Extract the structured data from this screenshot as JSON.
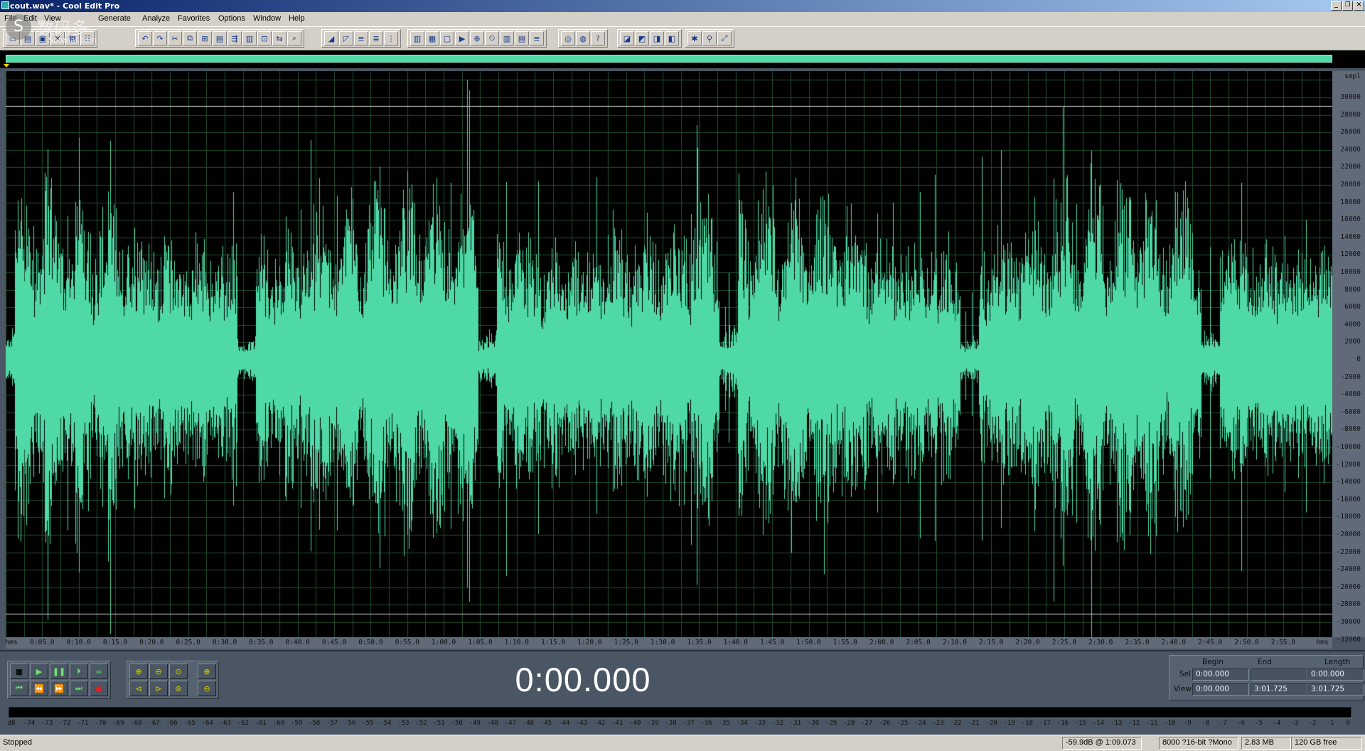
{
  "window": {
    "title": "cout.wav* - Cool Edit Pro",
    "controls": [
      "_",
      "❐",
      "✕"
    ]
  },
  "menu": [
    "File",
    "Edit",
    "View",
    "Generate",
    "Analyze",
    "Favorites",
    "Options",
    "Window",
    "Help"
  ],
  "watermark": {
    "mark": "S",
    "text": "数码多",
    "url": "Soomal.com"
  },
  "toolbar_groups": [
    [
      "new-icon",
      "open-icon",
      "save-icon",
      "close-icon",
      "save-as-icon",
      "properties-icon"
    ],
    [
      "undo-icon",
      "redo-icon",
      "cut-icon",
      "copy-icon",
      "copy-new-icon",
      "paste-icon",
      "paste-mix-icon",
      "mix-paste-icon",
      "trim-icon",
      "convert-icon",
      "find-icon"
    ],
    [
      "envelope-icon",
      "amplify-icon",
      "eq-icon",
      "noise-icon",
      "delay-icon"
    ],
    [
      "snap-icon",
      "grid-icon",
      "frame-icon",
      "play-icon",
      "zoom-icon",
      "time-icon",
      "meter-icon",
      "spectral-icon",
      "cue-icon"
    ],
    [
      "cd-icon",
      "batch-icon",
      "help-icon"
    ],
    [
      "multitrack-icon",
      "edit-view-icon",
      "cd-view-icon",
      "script-icon"
    ],
    [
      "dither-icon",
      "link-icon",
      "hotkey-icon"
    ]
  ],
  "waveform": {
    "color": "#4fd9a6",
    "background": "#000000",
    "grid_color": "#1f4f2f",
    "y_axis_unit": "smpl",
    "y_labels": [
      "30000",
      "28000",
      "26000",
      "24000",
      "22000",
      "20000",
      "18000",
      "16000",
      "14000",
      "12000",
      "10000",
      "8000",
      "6000",
      "4000",
      "2000",
      "0",
      "-2000",
      "-4000",
      "-6000",
      "-8000",
      "-10000",
      "-12000",
      "-14000",
      "-16000",
      "-18000",
      "-20000",
      "-22000",
      "-24000",
      "-26000",
      "-28000",
      "-30000",
      "-32000"
    ],
    "x_axis_unit": "hms",
    "x_labels": [
      "0:05.0",
      "0:10.0",
      "0:15.0",
      "0:20.0",
      "0:25.0",
      "0:30.0",
      "0:35.0",
      "0:40.0",
      "0:45.0",
      "0:50.0",
      "0:55.0",
      "1:00.0",
      "1:05.0",
      "1:10.0",
      "1:15.0",
      "1:20.0",
      "1:25.0",
      "1:30.0",
      "1:35.0",
      "1:40.0",
      "1:45.0",
      "1:50.0",
      "1:55.0",
      "2:00.0",
      "2:05.0",
      "2:10.0",
      "2:15.0",
      "2:20.0",
      "2:25.0",
      "2:30.0",
      "2:35.0",
      "2:40.0",
      "2:45.0",
      "2:50.0",
      "2:55.0"
    ]
  },
  "transport": {
    "row1": [
      "stop-icon",
      "play-icon",
      "pause-icon",
      "play-to-end-icon",
      "loop-icon"
    ],
    "row2": [
      "go-to-start-icon",
      "rewind-icon",
      "fast-forward-icon",
      "go-to-end-icon",
      "record-icon"
    ],
    "zoom_row1": [
      "zoom-in-icon",
      "zoom-out-icon",
      "zoom-full-icon",
      "",
      "zoom-in-vertical-icon"
    ],
    "zoom_row2": [
      "zoom-left-icon",
      "zoom-right-icon",
      "zoom-selection-icon",
      "",
      "zoom-out-vertical-icon"
    ],
    "time": "0:00.000"
  },
  "selection": {
    "headers": {
      "begin": "Begin",
      "end": "End",
      "length": "Length"
    },
    "sel_label": "Sel",
    "view_label": "View",
    "sel": {
      "begin": "0:00.000",
      "end": "",
      "length": "0:00.000"
    },
    "view": {
      "begin": "0:00.000",
      "end": "3:01.725",
      "length": "3:01.725"
    }
  },
  "meter": {
    "labels": [
      "dB",
      "-74",
      "-73",
      "-72",
      "-71",
      "-70",
      "-69",
      "-68",
      "-67",
      "-66",
      "-65",
      "-64",
      "-63",
      "-62",
      "-61",
      "-60",
      "-59",
      "-58",
      "-57",
      "-56",
      "-55",
      "-54",
      "-53",
      "-52",
      "-51",
      "-50",
      "-49",
      "-48",
      "-47",
      "-46",
      "-45",
      "-44",
      "-43",
      "-42",
      "-41",
      "-40",
      "-39",
      "-38",
      "-37",
      "-36",
      "-35",
      "-34",
      "-33",
      "-32",
      "-31",
      "-30",
      "-29",
      "-28",
      "-27",
      "-26",
      "-25",
      "-24",
      "-23",
      "-22",
      "-21",
      "-20",
      "-19",
      "-18",
      "-17",
      "-16",
      "-15",
      "-14",
      "-13",
      "-12",
      "-11",
      "-10",
      "-9",
      "-8",
      "-7",
      "-6",
      "-5",
      "-4",
      "-3",
      "-2",
      "-1",
      "0"
    ]
  },
  "status": {
    "state": "Stopped",
    "level": "-59.9dB @  1:09.073",
    "format": "8000 ?16-bit ?Mono",
    "size": "2.83 MB",
    "free": "120 GB free"
  }
}
